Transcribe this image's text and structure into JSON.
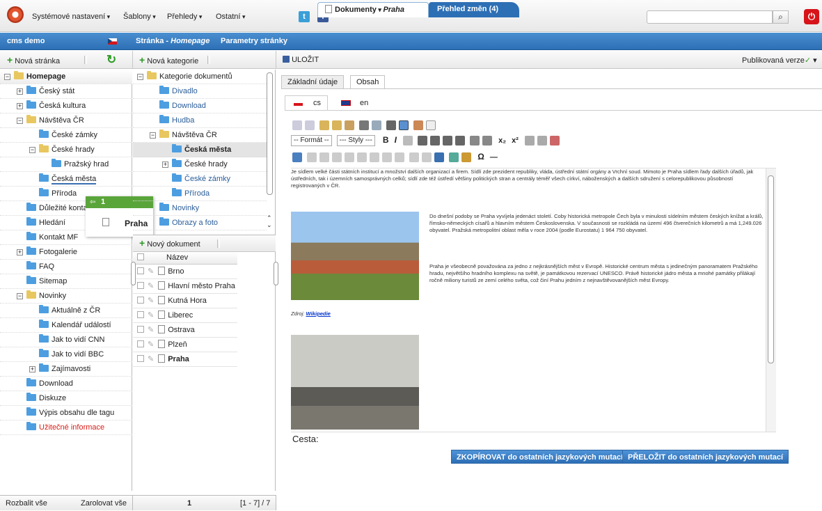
{
  "top_menu": {
    "items": [
      "Systémové nastavení",
      "Šablony",
      "Přehledy",
      "Ostatní"
    ],
    "social": [
      "t",
      "f"
    ]
  },
  "tabs": {
    "site": "cms demo",
    "stranka": "Stránka - ",
    "stranka_em": "Homepage",
    "parametry": "Parametry stránky",
    "dokumenty": "Dokumenty",
    "dokumenty_em": "Praha",
    "prehled": "Přehled změn (4)"
  },
  "left_toolbar": {
    "new_page": "Nová stránka"
  },
  "mid_toolbar": {
    "new_category": "Nová kategorie"
  },
  "right_toolbar": {
    "save": "ULOŽIT",
    "published": "Publikovaná verze"
  },
  "left_tree": [
    {
      "label": "Homepage",
      "level": 0,
      "exp": "−",
      "open": true,
      "bold": true
    },
    {
      "label": "Český stát",
      "level": 1,
      "exp": "+"
    },
    {
      "label": "Česká kultura",
      "level": 1,
      "exp": "+"
    },
    {
      "label": "Návštěva ČR",
      "level": 1,
      "exp": "−",
      "open": true
    },
    {
      "label": "České zámky",
      "level": 2
    },
    {
      "label": "České hrady",
      "level": 2,
      "exp": "−",
      "open": true
    },
    {
      "label": "Pražský hrad",
      "level": 3
    },
    {
      "label": "Česká města",
      "level": 2,
      "underline": true
    },
    {
      "label": "Příroda",
      "level": 2
    },
    {
      "label": "Důležité kontakty",
      "level": 1
    },
    {
      "label": "Hledání",
      "level": 1
    },
    {
      "label": "Kontakt MF",
      "level": 1
    },
    {
      "label": "Fotogalerie",
      "level": 1,
      "exp": "+"
    },
    {
      "label": "FAQ",
      "level": 1
    },
    {
      "label": "Sitemap",
      "level": 1
    },
    {
      "label": "Novinky",
      "level": 1,
      "exp": "−",
      "open": true
    },
    {
      "label": "Aktuálně z ČR",
      "level": 2
    },
    {
      "label": "Kalendář událostí",
      "level": 2
    },
    {
      "label": "Jak to vidí CNN",
      "level": 2
    },
    {
      "label": "Jak to vidí BBC",
      "level": 2
    },
    {
      "label": "Zajímavosti",
      "level": 2,
      "exp": "+"
    },
    {
      "label": "Download",
      "level": 1
    },
    {
      "label": "Diskuze",
      "level": 1
    },
    {
      "label": "Výpis obsahu dle tagu",
      "level": 1
    },
    {
      "label": "Užitečné informace",
      "level": 1,
      "red": true
    }
  ],
  "categories": [
    {
      "label": "Kategorie dokumentů",
      "level": 0,
      "exp": "−",
      "open": true
    },
    {
      "label": "Divadlo",
      "level": 1
    },
    {
      "label": "Download",
      "level": 1
    },
    {
      "label": "Hudba",
      "level": 1
    },
    {
      "label": "Návštěva ČR",
      "level": 1,
      "exp": "−",
      "open": true
    },
    {
      "label": "Česká města",
      "level": 2,
      "bold": true,
      "selected": true
    },
    {
      "label": "České hrady",
      "level": 2,
      "exp": "+"
    },
    {
      "label": "České zámky",
      "level": 2
    },
    {
      "label": "Příroda",
      "level": 2
    },
    {
      "label": "Novinky",
      "level": 1
    },
    {
      "label": "Obrazy a foto",
      "level": 1
    }
  ],
  "documents": {
    "new_doc": "Nový dokument",
    "header": "Název",
    "rows": [
      "Brno",
      "Hlavní město Praha",
      "Kutná Hora",
      "Liberec",
      "Ostrava",
      "Plzeň",
      "Praha"
    ]
  },
  "drag": {
    "count": "1",
    "label": "Praha"
  },
  "editor": {
    "tabs": [
      "Základní údaje",
      "Obsah"
    ],
    "langs": [
      "cs",
      "en"
    ],
    "format": "-- Formát --",
    "styles": "--- Styly ---",
    "p1": "Je sídlem velké části státních institucí a množství dalších organizací a firem. Sídlí zde prezident republiky, vláda, ústřední státní orgány a Vrchní soud. Mimoto je Praha sídlem řady dalších úřadů, jak ústředních, tak i územních samosprávných celků; sídlí zde též ústředí většiny politických stran a centrály téměř všech církví, náboženských a dalších sdružení s celorepublikovou působností registrovaných v ČR.",
    "p2": "Do dnešní podoby se Praha vyvíjela jedenáct století. Coby historická metropole Čech byla v minulosti sídelním městem českých knížat a králů, římsko-německých císařů a hlavním městem Československa. V současnosti se rozkládá na území 496 čtverečních kilometrů a má 1,249.026 obyvatel. Pražská metropolitní oblast měla v roce 2004 (podle Eurostatu) 1 964 750 obyvatel.",
    "p3": "Praha je všeobecně považována za jedno z nejkrásnějších měst v Evropě. Historické centrum města s jedinečným panoramatem Pražského hradu, největšího hradního komplexu na světě, je památkovou rezervací UNESCO. Právě historické jádro města a mnohé památky přilákají ročně miliony turistů ze zemí celého světa, což činí Prahu jedním z nejnavštěvovanějších měst Evropy.",
    "source_label": "Zdroj: ",
    "source_link": "Wikipedie",
    "path": "Cesta:",
    "copy_btn": "ZKOPÍROVAT do ostatních jazykových mutací",
    "translate_btn": "PŘELOŽIT do ostatních jazykových mutací"
  },
  "status": {
    "expand": "Rozbalit vše",
    "collapse": "Zarolovat vše",
    "page": "1",
    "range": "[1 - 7] / 7"
  }
}
